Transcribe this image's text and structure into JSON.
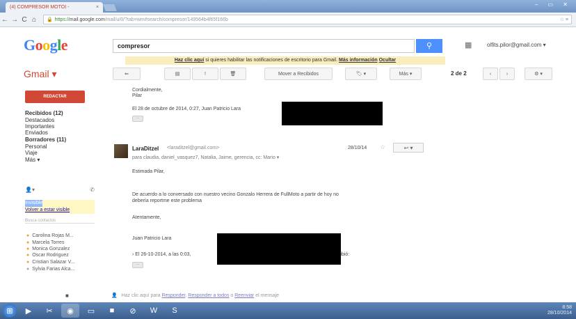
{
  "browser": {
    "tab_title": "(4) COMPRESOR MOTOI - ",
    "tab_close": "×",
    "url_https": "https://",
    "url_host": "mail.google.com",
    "url_rest": "/mail/u/0/?tab=wm#search/compresor/149564b4f65f166b",
    "window_controls": "–  ▭  ✕"
  },
  "header": {
    "logo_letters": [
      {
        "ch": "G",
        "color": "#4285f4"
      },
      {
        "ch": "o",
        "color": "#ea4335"
      },
      {
        "ch": "o",
        "color": "#fbbc05"
      },
      {
        "ch": "g",
        "color": "#4285f4"
      },
      {
        "ch": "l",
        "color": "#34a853"
      },
      {
        "ch": "e",
        "color": "#ea4335"
      }
    ],
    "search_value": "compresor",
    "account": "olfits.pilor@gmail.com ▾",
    "gmail_label": "Gmail ▾"
  },
  "notification": {
    "link": "Haz clic aquí",
    "text": " si quieres habilitar las notificaciones de escritorio para Gmail. ",
    "more": "Más información",
    "hide": "Ocultar"
  },
  "toolbar": {
    "back": "⇐",
    "archive": "▤",
    "spam": "!",
    "delete": "🗑",
    "move": "Mover a Recibidos",
    "labels": "🏷 ▾",
    "more": "Más ▾",
    "page_count": "2 de 2",
    "prev": "‹",
    "next": "›",
    "settings": "⚙ ▾"
  },
  "sidebar": {
    "compose": "REDACTAR",
    "items": [
      {
        "label": "Recibidos (12)",
        "bold": true
      },
      {
        "label": "Destacados",
        "bold": false
      },
      {
        "label": "Importantes",
        "bold": false
      },
      {
        "label": "Enviados",
        "bold": false
      },
      {
        "label": "Borradores (11)",
        "bold": true
      },
      {
        "label": "Personal",
        "bold": false
      },
      {
        "label": "Viaje",
        "bold": false
      },
      {
        "label": "Más ▾",
        "bold": false
      }
    ]
  },
  "chat": {
    "status_line": "Invisible",
    "status_link": "Volver a estar visible",
    "search_placeholder": "Busca contactos",
    "contacts": [
      {
        "name": "Carolina Rojas M..."
      },
      {
        "name": "Marcela Torres"
      },
      {
        "name": "Monica Gonzalez"
      },
      {
        "name": "Oscar Rodriguez"
      },
      {
        "name": "Cristian Salazar V..."
      },
      {
        "name": "Sylvia Farias Alca..."
      }
    ]
  },
  "mail": {
    "prev_close": "Cordialmente,",
    "prev_sign": "Pilar",
    "prev_quote": "El 28 de octubre de 2014, 0:27, Juan Patricio Lara",
    "sender_name": "LaraDitzel",
    "sender_email": "<laraditzel@gmail.com>",
    "date": "28/10/14",
    "to_line": "para claudia, daniel_vasquez7, Natalia, Jaime, gerencia, cc: Mario ▾",
    "greeting": "Estimada Pilar,",
    "body1": "De acuerdo a lo conversado con nuestro vecino Gonzalo Herrera de FullMoto a partir de hoy no",
    "body2": "debería reportme este problema",
    "closing": "Atentamente,",
    "sign": "Juan Patricio Lara",
    "quote": "› El 26-10-2014, a las 0:03,",
    "quote_end": "ribió:",
    "reply_bar_start": "Haz clic aquí",
    "reply_bar_mid": " para ",
    "reply_link_responder": "Responder",
    "reply_sep1": ", ",
    "reply_link_all": "Responder a todos",
    "reply_sep2": " o ",
    "reply_link_forward": "Reenviar",
    "reply_end": " el mensaje"
  },
  "taskbar": {
    "clock_time": "8:58",
    "clock_date": "28/10/2014"
  }
}
